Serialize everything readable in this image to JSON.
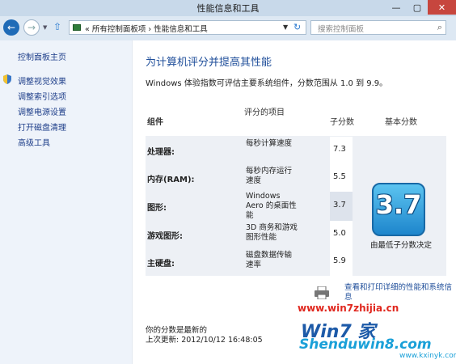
{
  "window": {
    "title": "性能信息和工具",
    "min": "—",
    "max": "▢",
    "close": "✕"
  },
  "nav": {
    "breadcrumb_prefix": "«",
    "breadcrumb_root": "所有控制面板项",
    "breadcrumb_sep": "›",
    "breadcrumb_current": "性能信息和工具",
    "search_placeholder": "搜索控制面板"
  },
  "sidebar": {
    "home": "控制面板主页",
    "items": [
      {
        "label": "调整视觉效果"
      },
      {
        "label": "调整索引选项"
      },
      {
        "label": "调整电源设置"
      },
      {
        "label": "打开磁盘清理"
      },
      {
        "label": "高级工具"
      }
    ]
  },
  "main": {
    "heading": "为计算机评分并提高其性能",
    "description": "Windows 体验指数可评估主要系统组件，分数范围从 1.0 到 9.9。",
    "columns": {
      "component": "组件",
      "rated_item": "评分的项目",
      "subscore": "子分数",
      "base_score": "基本分数"
    },
    "rows": [
      {
        "component": "处理器:",
        "desc": "每秒计算速度",
        "score": "7.3"
      },
      {
        "component": "内存(RAM):",
        "desc": "每秒内存运行速度",
        "score": "5.5"
      },
      {
        "component": "图形:",
        "desc": "Windows Aero 的桌面性能",
        "score": "3.7"
      },
      {
        "component": "游戏图形:",
        "desc": "3D 商务和游戏图形性能",
        "score": "5.0"
      },
      {
        "component": "主硬盘:",
        "desc": "磁盘数据传输速率",
        "score": "5.9"
      }
    ],
    "base_score": "3.7",
    "base_note": "由最低子分数决定",
    "print_link": "查看和打印详细的性能和系统信息",
    "status": "你的分数是最新的",
    "last_update": "上次更新: 2012/10/12 16:48:05"
  },
  "watermark": {
    "line1": "www.win7zhijia.cn",
    "logo": "Win7 家",
    "line2": "Shenduwin8.com",
    "line3": "www.kxinyk.com"
  }
}
